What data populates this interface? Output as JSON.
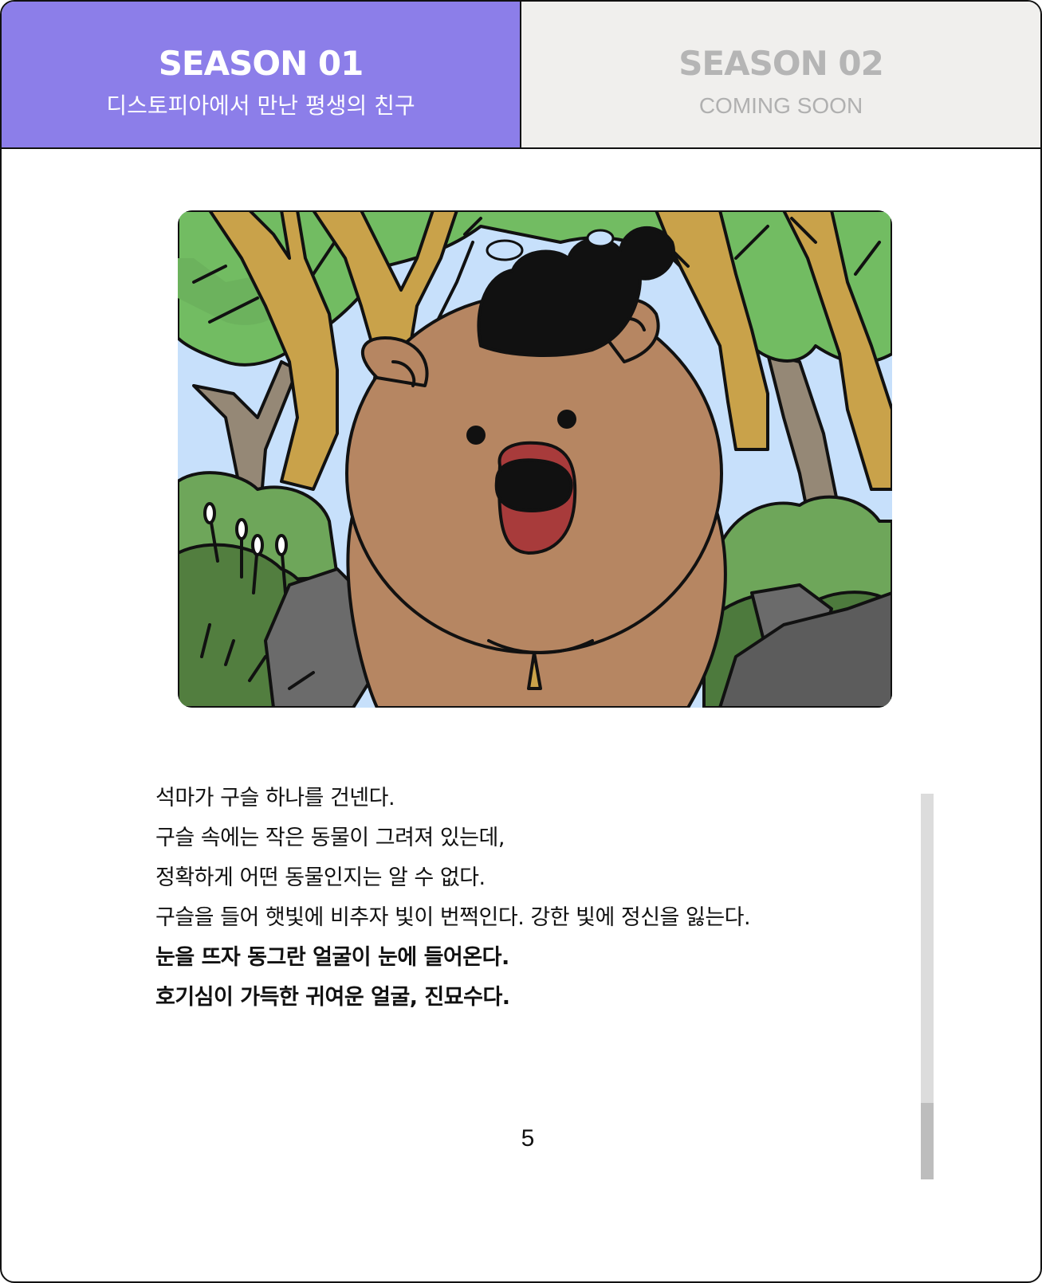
{
  "tabs": [
    {
      "title": "SEASON 01",
      "subtitle": "디스토피아에서 만난 평생의 친구",
      "active": true
    },
    {
      "title": "SEASON 02",
      "subtitle": "COMING SOON",
      "active": false
    }
  ],
  "illustration": {
    "icon": "brown-creature-in-forest-illustration"
  },
  "story": {
    "lines": [
      {
        "text": "석마가 구슬 하나를 건넨다.",
        "bold": false
      },
      {
        "text": "구슬 속에는 작은 동물이 그려져 있는데,",
        "bold": false
      },
      {
        "text": "정확하게 어떤 동물인지는 알 수 없다.",
        "bold": false
      },
      {
        "text": "구슬을 들어 햇빛에 비추자 빛이 번쩍인다. 강한 빛에 정신을 잃는다.",
        "bold": false
      },
      {
        "text": "눈을 뜨자 동그란 얼굴이 눈에 들어온다.",
        "bold": true
      },
      {
        "text": "호기심이 가득한 귀여운 얼굴, 진묘수다.",
        "bold": true
      }
    ]
  },
  "page_number": "5",
  "scroll": {
    "position": 1.0
  },
  "colors": {
    "accent": "#8c7ee9",
    "inactive_tab": "#f0efed"
  }
}
